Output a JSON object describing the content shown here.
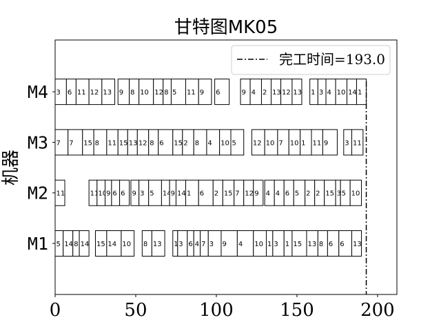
{
  "chart_data": {
    "type": "gantt",
    "title": "甘特图MK05",
    "ylabel": "机器",
    "xlabel": "",
    "xlim": [
      0,
      212
    ],
    "x_ticks": [
      0,
      50,
      100,
      150,
      200
    ],
    "legend": {
      "label": "完工时间=193.0",
      "placement": "top-right",
      "value": 193.0,
      "line_style": "dash-dot",
      "color": "#000000"
    },
    "grid": false,
    "machines": [
      {
        "name": "M1",
        "tasks": [
          {
            "job": "5",
            "start": 0,
            "end": 5
          },
          {
            "job": "14",
            "start": 5,
            "end": 11
          },
          {
            "job": "8",
            "start": 11,
            "end": 15
          },
          {
            "job": "14",
            "start": 15,
            "end": 21
          },
          {
            "job": "15",
            "start": 25,
            "end": 32
          },
          {
            "job": "14",
            "start": 32,
            "end": 41
          },
          {
            "job": "10",
            "start": 41,
            "end": 49
          },
          {
            "job": "8",
            "start": 54,
            "end": 60
          },
          {
            "job": "13",
            "start": 60,
            "end": 68
          },
          {
            "job": "14",
            "start": 73,
            "end": 76
          },
          {
            "job": "3",
            "start": 76,
            "end": 82
          },
          {
            "job": "6",
            "start": 82,
            "end": 86
          },
          {
            "job": "4",
            "start": 86,
            "end": 90
          },
          {
            "job": "7",
            "start": 90,
            "end": 95
          },
          {
            "job": "3",
            "start": 95,
            "end": 103
          },
          {
            "job": "9",
            "start": 103,
            "end": 113
          },
          {
            "job": "4",
            "start": 113,
            "end": 123
          },
          {
            "job": "10",
            "start": 123,
            "end": 131
          },
          {
            "job": "1",
            "start": 131,
            "end": 135
          },
          {
            "job": "3",
            "start": 135,
            "end": 142
          },
          {
            "job": "1",
            "start": 142,
            "end": 147
          },
          {
            "job": "15",
            "start": 147,
            "end": 156
          },
          {
            "job": "13",
            "start": 156,
            "end": 163
          },
          {
            "job": "8",
            "start": 163,
            "end": 169
          },
          {
            "job": "6",
            "start": 169,
            "end": 176
          },
          {
            "job": "6",
            "start": 176,
            "end": 184
          },
          {
            "job": "13",
            "start": 184,
            "end": 190
          }
        ]
      },
      {
        "name": "M2",
        "tasks": [
          {
            "job": "11",
            "start": 0,
            "end": 6
          },
          {
            "job": "11",
            "start": 21,
            "end": 26
          },
          {
            "job": "10",
            "start": 26,
            "end": 31
          },
          {
            "job": "9",
            "start": 31,
            "end": 35
          },
          {
            "job": "6",
            "start": 35,
            "end": 40
          },
          {
            "job": "6",
            "start": 40,
            "end": 46
          },
          {
            "job": "9",
            "start": 47,
            "end": 52
          },
          {
            "job": "3",
            "start": 52,
            "end": 58
          },
          {
            "job": "5",
            "start": 58,
            "end": 66
          },
          {
            "job": "14",
            "start": 66,
            "end": 71
          },
          {
            "job": "9",
            "start": 71,
            "end": 75
          },
          {
            "job": "14",
            "start": 75,
            "end": 81
          },
          {
            "job": "1",
            "start": 81,
            "end": 89
          },
          {
            "job": "6",
            "start": 89,
            "end": 98
          },
          {
            "job": "2",
            "start": 98,
            "end": 104
          },
          {
            "job": "15",
            "start": 104,
            "end": 111
          },
          {
            "job": "7",
            "start": 111,
            "end": 117
          },
          {
            "job": "12",
            "start": 117,
            "end": 123
          },
          {
            "job": "9",
            "start": 123,
            "end": 129
          },
          {
            "job": "4",
            "start": 130,
            "end": 136
          },
          {
            "job": "4",
            "start": 136,
            "end": 142
          },
          {
            "job": "6",
            "start": 142,
            "end": 148
          },
          {
            "job": "5",
            "start": 148,
            "end": 155
          },
          {
            "job": "2",
            "start": 155,
            "end": 161
          },
          {
            "job": "2",
            "start": 161,
            "end": 167
          },
          {
            "job": "15",
            "start": 167,
            "end": 174
          },
          {
            "job": "3",
            "start": 174,
            "end": 177
          },
          {
            "job": "5",
            "start": 177,
            "end": 183
          },
          {
            "job": "10",
            "start": 183,
            "end": 190
          }
        ]
      },
      {
        "name": "M3",
        "tasks": [
          {
            "job": "7",
            "start": 0,
            "end": 8
          },
          {
            "job": "7",
            "start": 8,
            "end": 17
          },
          {
            "job": "15",
            "start": 17,
            "end": 24
          },
          {
            "job": "8",
            "start": 24,
            "end": 32
          },
          {
            "job": "11",
            "start": 32,
            "end": 39
          },
          {
            "job": "15",
            "start": 39,
            "end": 45
          },
          {
            "job": "13",
            "start": 45,
            "end": 51
          },
          {
            "job": "12",
            "start": 51,
            "end": 58
          },
          {
            "job": "8",
            "start": 58,
            "end": 64
          },
          {
            "job": "6",
            "start": 64,
            "end": 73
          },
          {
            "job": "15",
            "start": 73,
            "end": 79
          },
          {
            "job": "2",
            "start": 79,
            "end": 86
          },
          {
            "job": "8",
            "start": 86,
            "end": 94
          },
          {
            "job": "4",
            "start": 94,
            "end": 102
          },
          {
            "job": "10",
            "start": 102,
            "end": 109
          },
          {
            "job": "5",
            "start": 109,
            "end": 117
          },
          {
            "job": "12",
            "start": 122,
            "end": 130
          },
          {
            "job": "10",
            "start": 130,
            "end": 138
          },
          {
            "job": "7",
            "start": 138,
            "end": 145
          },
          {
            "job": "10",
            "start": 145,
            "end": 152
          },
          {
            "job": "1",
            "start": 152,
            "end": 159
          },
          {
            "job": "11",
            "start": 159,
            "end": 166
          },
          {
            "job": "9",
            "start": 166,
            "end": 175
          },
          {
            "job": "3",
            "start": 179,
            "end": 184
          },
          {
            "job": "11",
            "start": 184,
            "end": 191
          }
        ]
      },
      {
        "name": "M4",
        "tasks": [
          {
            "job": "3",
            "start": 0,
            "end": 7
          },
          {
            "job": "6",
            "start": 7,
            "end": 13
          },
          {
            "job": "11",
            "start": 13,
            "end": 21
          },
          {
            "job": "12",
            "start": 21,
            "end": 29
          },
          {
            "job": "13",
            "start": 29,
            "end": 37
          },
          {
            "job": "9",
            "start": 39,
            "end": 46
          },
          {
            "job": "8",
            "start": 46,
            "end": 52
          },
          {
            "job": "10",
            "start": 52,
            "end": 61
          },
          {
            "job": "12",
            "start": 61,
            "end": 67
          },
          {
            "job": "8",
            "start": 67,
            "end": 72
          },
          {
            "job": "5",
            "start": 72,
            "end": 81
          },
          {
            "job": "11",
            "start": 81,
            "end": 89
          },
          {
            "job": "9",
            "start": 89,
            "end": 97
          },
          {
            "job": "6",
            "start": 99,
            "end": 108
          },
          {
            "job": "9",
            "start": 115,
            "end": 121
          },
          {
            "job": "4",
            "start": 121,
            "end": 128
          },
          {
            "job": "2",
            "start": 128,
            "end": 134
          },
          {
            "job": "13",
            "start": 134,
            "end": 140
          },
          {
            "job": "12",
            "start": 140,
            "end": 147
          },
          {
            "job": "13",
            "start": 147,
            "end": 153
          },
          {
            "job": "1",
            "start": 158,
            "end": 163
          },
          {
            "job": "3",
            "start": 163,
            "end": 168
          },
          {
            "job": "4",
            "start": 168,
            "end": 174
          },
          {
            "job": "10",
            "start": 174,
            "end": 181
          },
          {
            "job": "14",
            "start": 181,
            "end": 187
          },
          {
            "job": "1",
            "start": 187,
            "end": 193
          }
        ]
      }
    ]
  }
}
